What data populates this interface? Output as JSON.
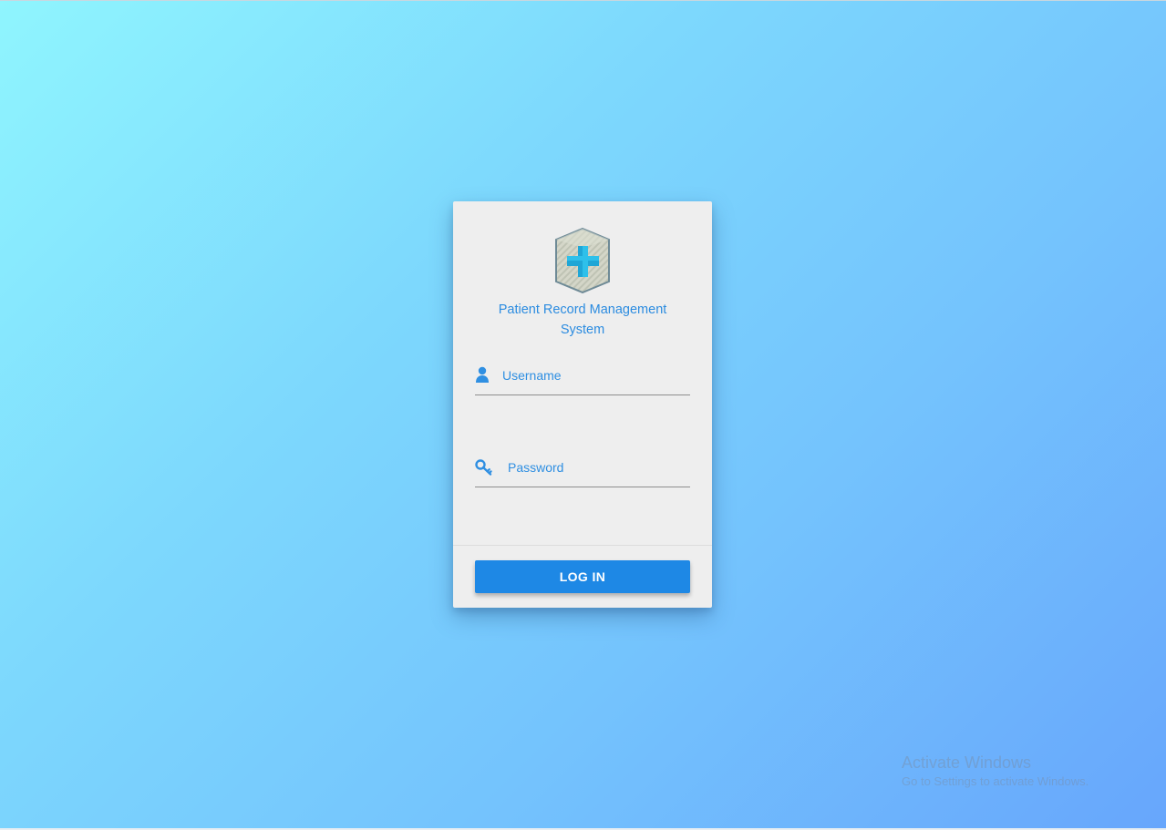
{
  "app": {
    "title": "Patient Record Management System",
    "logo_icon": "medical-cross-shield-icon",
    "accent_color": "#1e88e5",
    "title_color": "#2c8ce0"
  },
  "login": {
    "username": {
      "icon": "user-icon",
      "placeholder": "Username",
      "value": ""
    },
    "password": {
      "icon": "key-icon",
      "placeholder": "Password",
      "value": ""
    },
    "submit_label": "LOG IN"
  },
  "watermark": {
    "title": "Activate Windows",
    "subtitle": "Go to Settings to activate Windows."
  }
}
